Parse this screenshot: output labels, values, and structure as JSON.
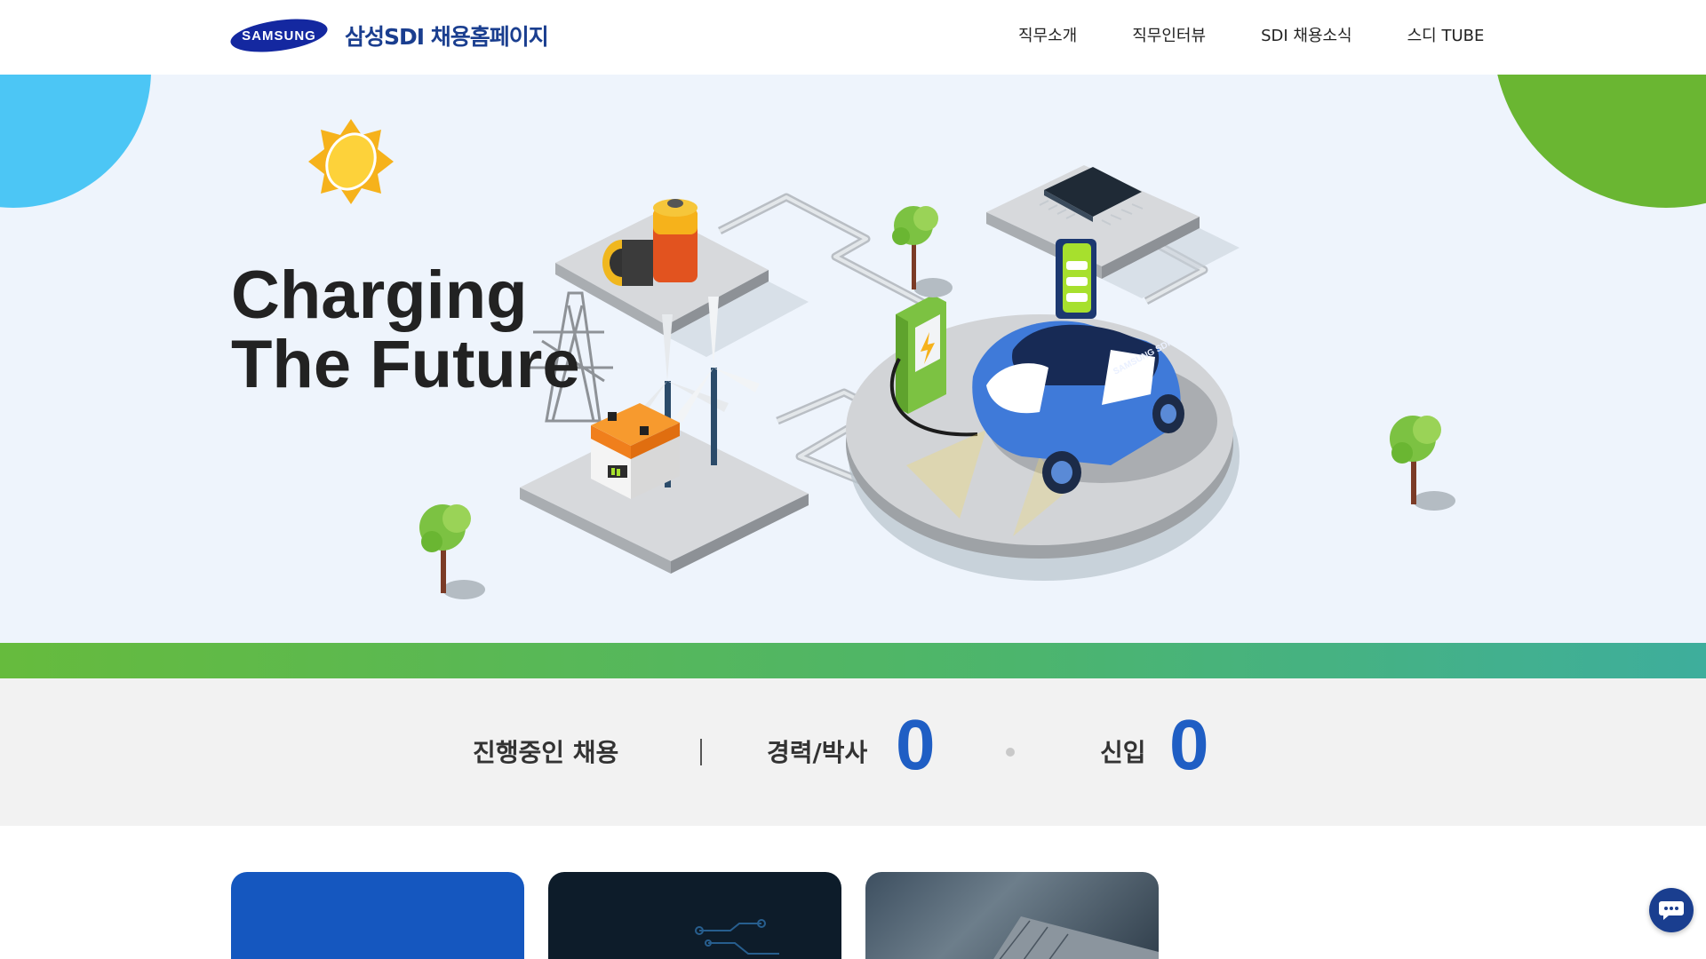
{
  "header": {
    "brand_logo_text": "SAMSUNG",
    "site_title": "삼성SDI 채용홈페이지",
    "nav": [
      {
        "label": "직무소개"
      },
      {
        "label": "직무인터뷰"
      },
      {
        "label": "SDI 채용소식"
      },
      {
        "label": "스디 TUBE"
      }
    ]
  },
  "hero": {
    "title_line1": "Charging",
    "title_line2": "The Future",
    "car_label": "SAMSUNG SDI"
  },
  "recruit": {
    "main_label": "진행중인 채용",
    "career_label": "경력/박사",
    "career_count": "0",
    "new_label": "신입",
    "new_count": "0"
  },
  "colors": {
    "brand_blue": "#1a3e8f",
    "count_blue": "#1f5ec4",
    "hero_bg": "#eef4fc",
    "accent_sky": "#4cc6f5",
    "accent_green": "#6ab632"
  },
  "icons": {
    "chat": "chat-bubble-icon"
  }
}
